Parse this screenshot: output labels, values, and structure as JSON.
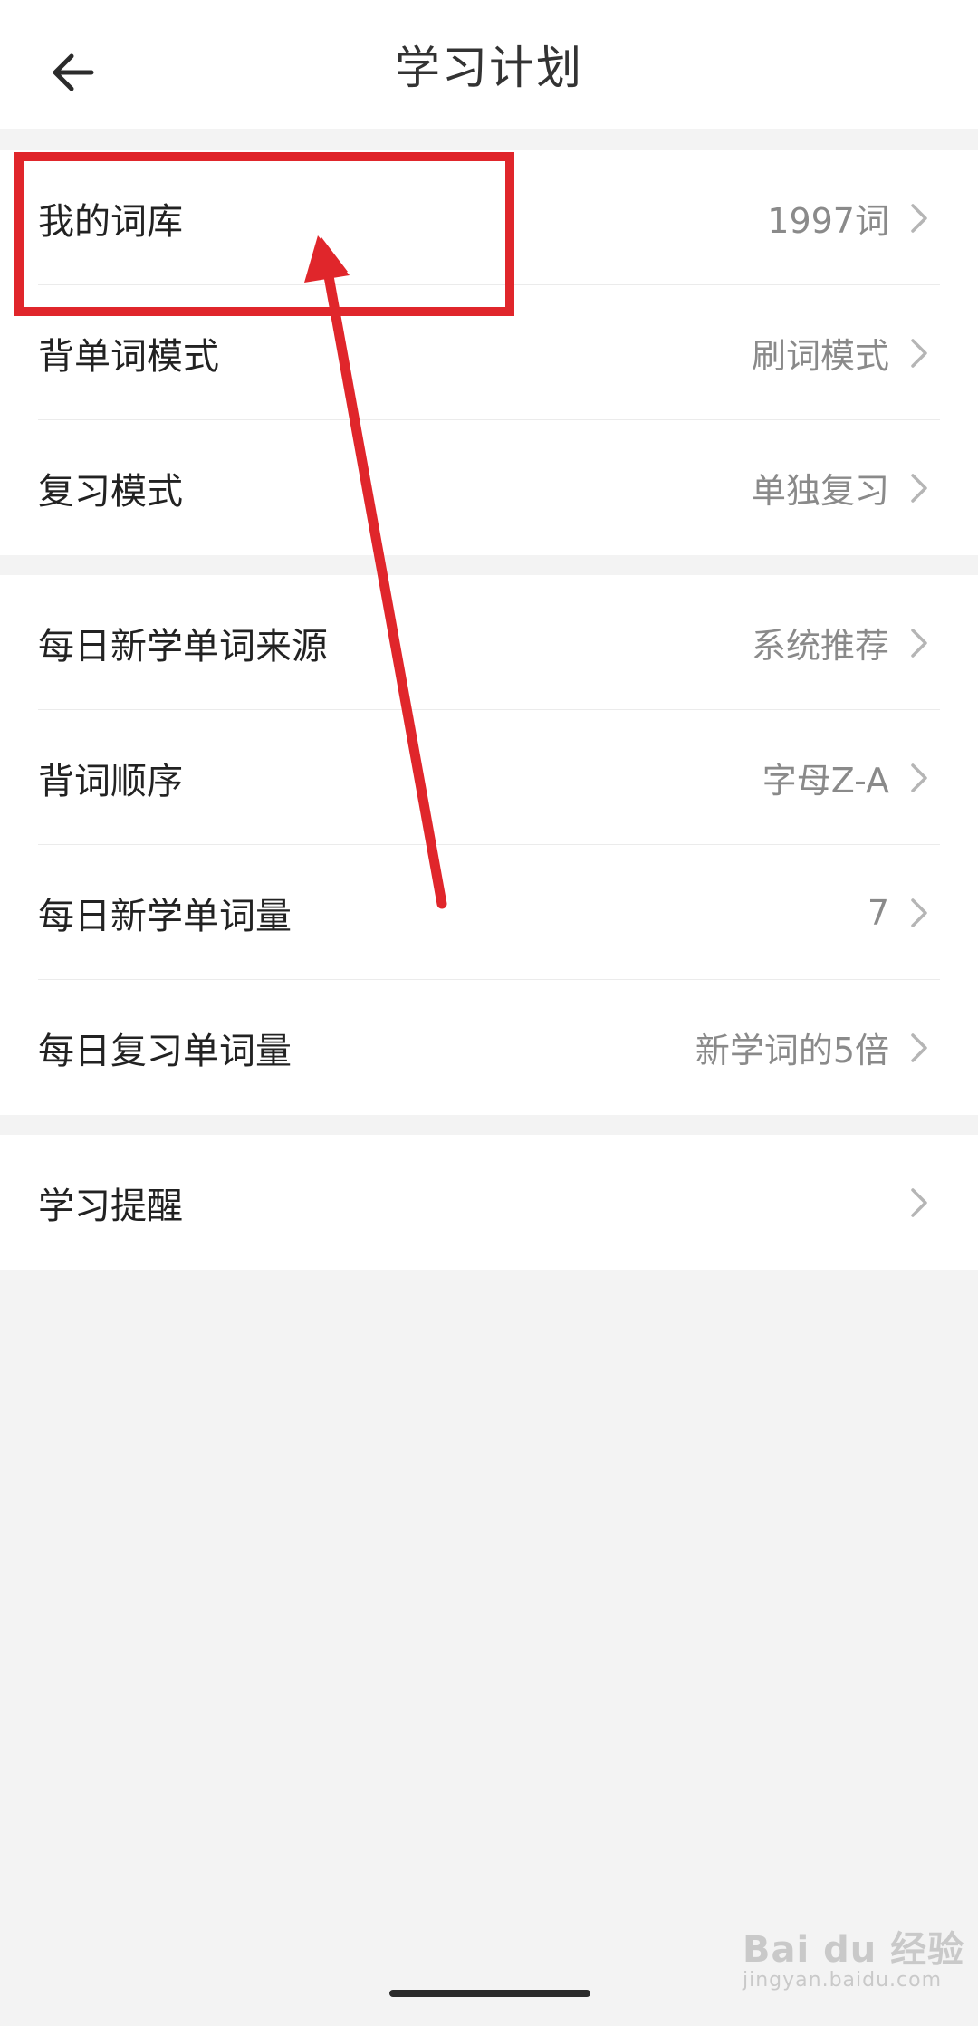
{
  "header": {
    "title": "学习计划",
    "back_icon": "arrow-left-icon"
  },
  "groups": [
    {
      "rows": [
        {
          "label": "我的词库",
          "value": "1997词"
        },
        {
          "label": "背单词模式",
          "value": "刷词模式"
        },
        {
          "label": "复习模式",
          "value": "单独复习"
        }
      ]
    },
    {
      "rows": [
        {
          "label": "每日新学单词来源",
          "value": "系统推荐"
        },
        {
          "label": "背词顺序",
          "value": "字母Z-A"
        },
        {
          "label": "每日新学单词量",
          "value": "7"
        },
        {
          "label": "每日复习单词量",
          "value": "新学词的5倍"
        }
      ]
    },
    {
      "rows": [
        {
          "label": "学习提醒",
          "value": ""
        }
      ]
    }
  ],
  "watermark": {
    "main": "Bai du 经验",
    "sub": "jingyan.baidu.com"
  },
  "colors": {
    "annotation_red": "#e0262b",
    "background": "#f3f3f3",
    "value_gray": "#8a8a8a"
  }
}
